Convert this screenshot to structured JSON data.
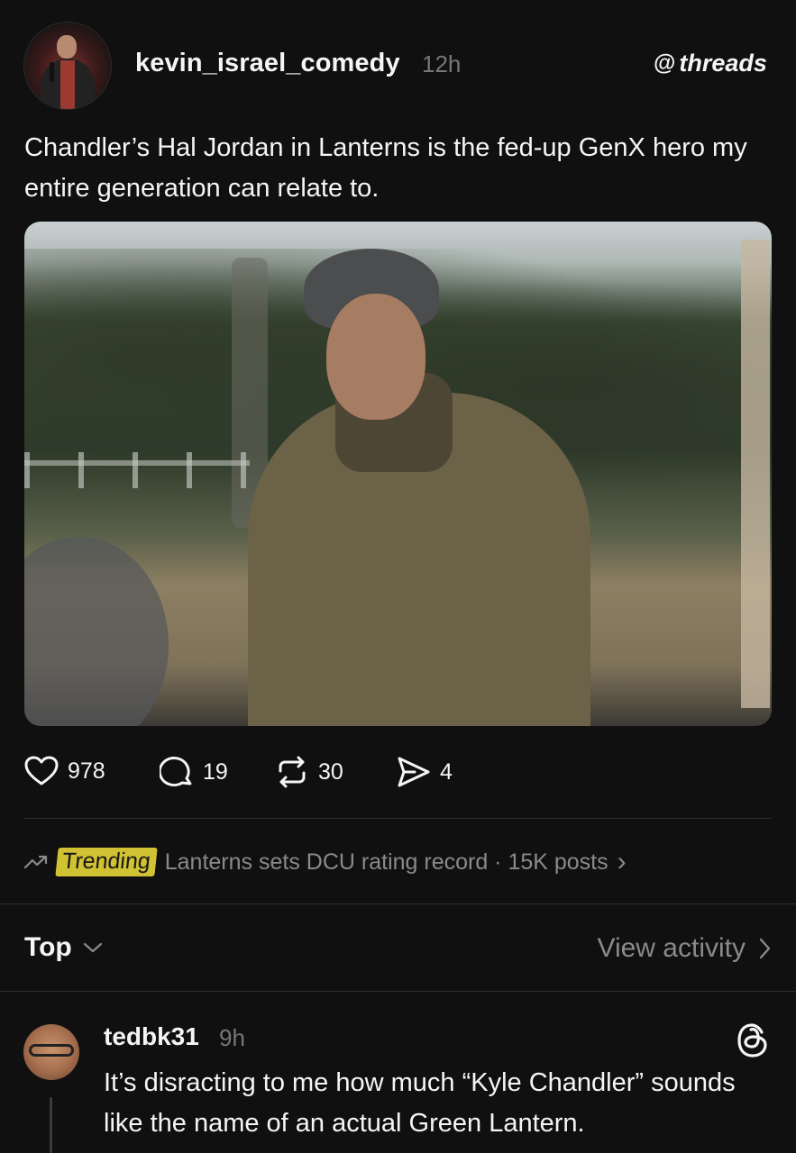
{
  "post": {
    "username": "kevin_israel_comedy",
    "time": "12h",
    "brand": "threads",
    "text": "Chandler’s Hal Jordan in Lanterns is the fed-up GenX hero my entire generation can relate to.",
    "stats": {
      "likes": "978",
      "replies": "19",
      "reposts": "30",
      "shares": "4"
    }
  },
  "trending": {
    "label": "Trending",
    "text": "Lanterns sets DCU rating record · 15K posts",
    "chevron": "›"
  },
  "replies_header": {
    "sort_label": "Top",
    "view_activity": "View activity"
  },
  "reply": {
    "username": "tedbk31",
    "time": "9h",
    "text": "It’s disracting to me how much “Kyle Chandler” sounds like the name of an actual Green Lantern."
  },
  "icons": {
    "like": "heart-icon",
    "reply": "speech-bubble-icon",
    "repost": "repost-icon",
    "share": "send-icon",
    "trending": "trending-arrow-icon",
    "sort": "chevron-down-icon",
    "view_activity": "chevron-right-icon",
    "threads": "threads-logo-icon"
  },
  "colors": {
    "background": "#101010",
    "text": "#f3f5f7",
    "muted": "#777777",
    "trending_highlight": "#f2e23a"
  }
}
